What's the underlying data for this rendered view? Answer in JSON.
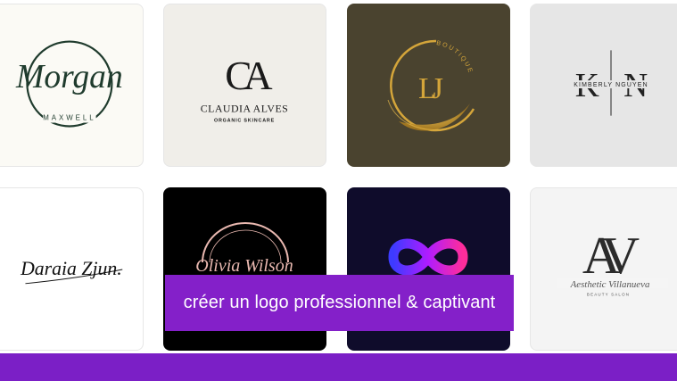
{
  "logos": [
    {
      "script_name": "Morgan",
      "sub_name": "MAXWELL",
      "style": "circular script signature",
      "colors": {
        "ink": "#1f3b2d",
        "bg": "#fbfaf5"
      }
    },
    {
      "monogram": "CA",
      "brand": "CLAUDIA ALVES",
      "tagline": "ORGANIC SKINCARE",
      "colors": {
        "ink": "#1a1a1a",
        "bg": "#f0eee9"
      }
    },
    {
      "monogram": "LJ",
      "arc_text": "BOUTIQUE",
      "colors": {
        "gold": "#d4a53a",
        "bg": "#4a432f"
      }
    },
    {
      "monogram_left": "K",
      "monogram_right": "N",
      "brand": "KIMBERLY NGUYEN",
      "colors": {
        "ink": "#222222",
        "bg": "#e6e6e6"
      }
    },
    {
      "signature": "Daraia Zjun.",
      "colors": {
        "ink": "#111111",
        "bg": "#ffffff"
      }
    },
    {
      "script_name": "Olivia Wilson",
      "colors": {
        "ink": "#e9b8b0",
        "bg": "#000000"
      }
    },
    {
      "icon": "infinity-icon",
      "colors": {
        "start": "#3d3bff",
        "mid": "#b01cff",
        "end": "#ff2d9a",
        "bg": "#0f0c2b"
      }
    },
    {
      "monogram": "AV",
      "script_line": "Aesthetic Villanueva",
      "tagline": "BEAUTY SALON",
      "colors": {
        "ink": "#2b2b2b",
        "bg": "#f4f4f4"
      }
    }
  ],
  "caption": "créer un logo professionnel & captivant",
  "accent_color": "#8420c9",
  "bar_color": "#7b1fc6"
}
